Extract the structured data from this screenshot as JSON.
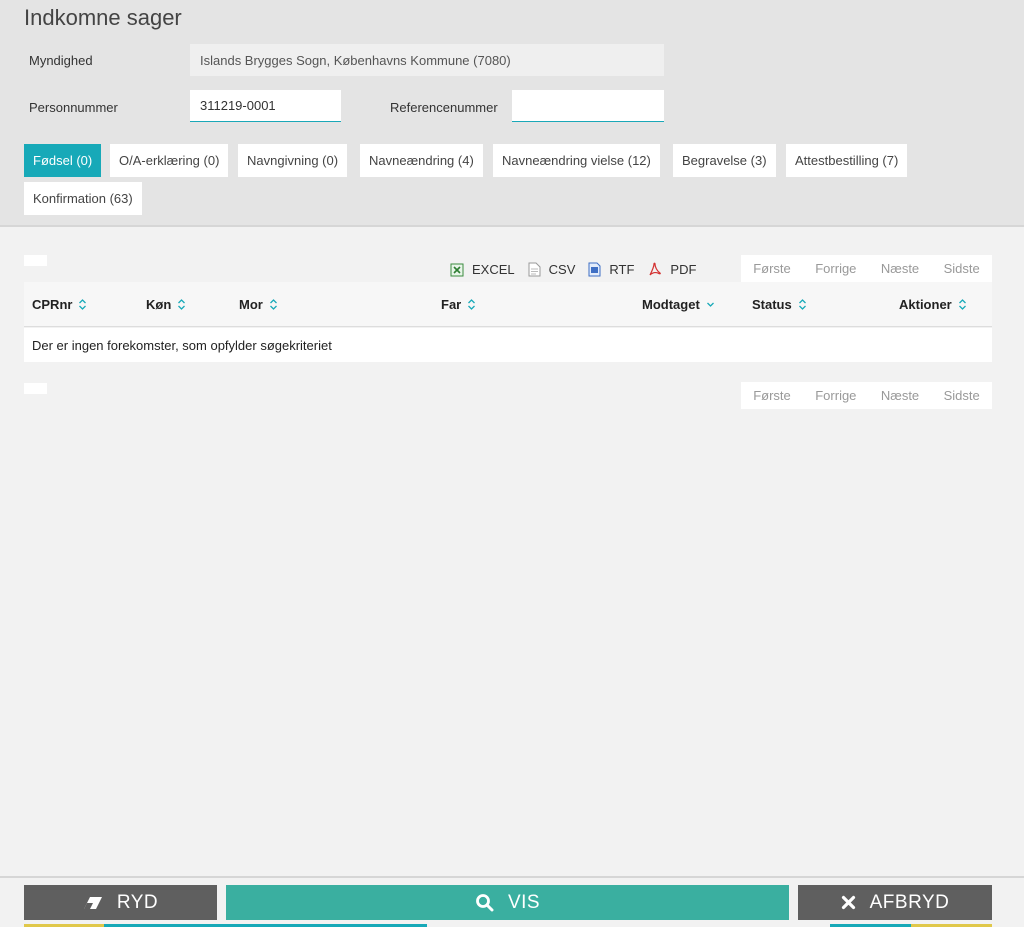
{
  "page": {
    "title": "Indkomne sager"
  },
  "form": {
    "authority_label": "Myndighed",
    "authority_value": "Islands Brygges Sogn, Københavns Kommune (7080)",
    "cpr_label": "Personnummer",
    "cpr_value": "311219-0001",
    "reference_label": "Referencenummer",
    "reference_value": ""
  },
  "tabs": [
    {
      "label": "Fødsel (0)",
      "active": true
    },
    {
      "label": "O/A-erklæring (0)"
    },
    {
      "label": "Navngivning (0)"
    },
    {
      "label": "Navneændring (4)"
    },
    {
      "label": "Navneændring vielse (12)"
    },
    {
      "label": "Begravelse (3)"
    },
    {
      "label": "Attestbestilling (7)"
    },
    {
      "label": "Konfirmation (63)"
    }
  ],
  "exports": {
    "excel": "EXCEL",
    "csv": "CSV",
    "rtf": "RTF",
    "pdf": "PDF"
  },
  "pager": {
    "first": "Første",
    "prev": "Forrige",
    "next": "Næste",
    "last": "Sidste"
  },
  "table": {
    "columns": [
      "CPRnr",
      "Køn",
      "Mor",
      "Far",
      "Modtaget",
      "Status",
      "Aktioner"
    ],
    "empty_message": "Der er ingen forekomster, som opfylder søgekriteriet"
  },
  "footer": {
    "clear": "RYD",
    "show": "VIS",
    "cancel": "AFBRYD"
  },
  "colors": {
    "accent": "#17a9b8",
    "primary_button": "#3aafa0",
    "secondary_button": "#5f5f5f"
  }
}
